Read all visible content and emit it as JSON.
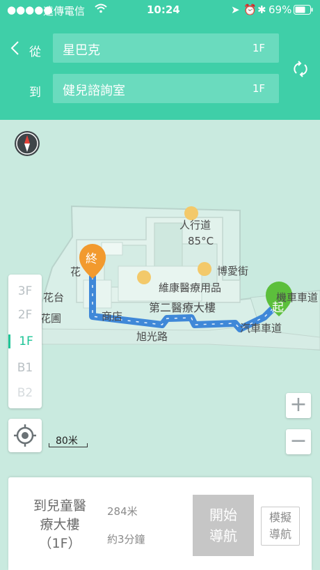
{
  "status": {
    "carrier": "遠傳電信",
    "time": "10:24",
    "battery": "69%"
  },
  "header": {
    "back_icon": "chevron-left-icon",
    "from_label": "從",
    "to_label": "到",
    "from": {
      "name": "星巴克",
      "floor": "1F"
    },
    "to": {
      "name": "健兒諮詢室",
      "floor": "1F"
    },
    "swap_icon": "swap-icon"
  },
  "map": {
    "labels": {
      "lift": "人行道",
      "temp": "85°C",
      "boai": "博愛街",
      "weikang": "維康醫療用品",
      "second": "第二醫療大樓",
      "shop": "商店",
      "road": "旭光路",
      "huatai": "花台",
      "huapu": "花圃",
      "moto": "機車車道",
      "car": "汽車車道",
      "hua": "花"
    },
    "end_marker": "終",
    "start_marker": "起",
    "scale": "80米"
  },
  "floors": [
    "3F",
    "2F",
    "1F",
    "B1",
    "B2"
  ],
  "active_floor": "1F",
  "zoom": {
    "in": "+",
    "out": "−"
  },
  "panel": {
    "destination": "到兒童醫療大樓（1F）",
    "distance": "284米",
    "duration": "約3分鐘",
    "start_nav": "開始導航",
    "simulate": "模擬導航"
  }
}
